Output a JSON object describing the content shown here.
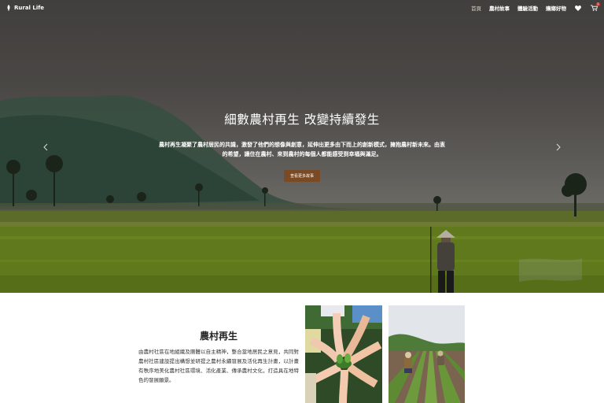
{
  "nav": {
    "brand": "Rural Life",
    "items": [
      {
        "label": "首頁",
        "active": true
      },
      {
        "label": "農村故事",
        "active": false
      },
      {
        "label": "體驗活動",
        "active": false
      },
      {
        "label": "購鄉好物",
        "active": false
      }
    ],
    "heart_icon": "heart-icon",
    "cart_icon": "cart-icon",
    "cart_count": "1"
  },
  "hero": {
    "title": "細數農村再生 改變持續發生",
    "description": "農村再生凝聚了農村居民的共識，激發了他們的想像與創意，延伸出更多由下而上的創新模式，擁抱農村新未來。由衷的希望，讓住在農村、來到農村的每個人都能感受到幸福與滿足。",
    "button_label": "查看更多故事",
    "prev_icon": "chevron-left-icon",
    "next_icon": "chevron-right-icon"
  },
  "intro": {
    "title": "農村再生",
    "body": "由農村社區在地組織及團體以自主精神，整合當地居民之意見，共同對農村社區建設提出構想並研提之農村永續發展及活化再生計畫，以計畫有秩序地美化農村社區環境、活化產業、傳承農村文化，打造具在地特色的發展願景。"
  },
  "colors": {
    "button": "#7a4a24",
    "badge": "#d8403a",
    "field_green": "#6f8a22"
  }
}
